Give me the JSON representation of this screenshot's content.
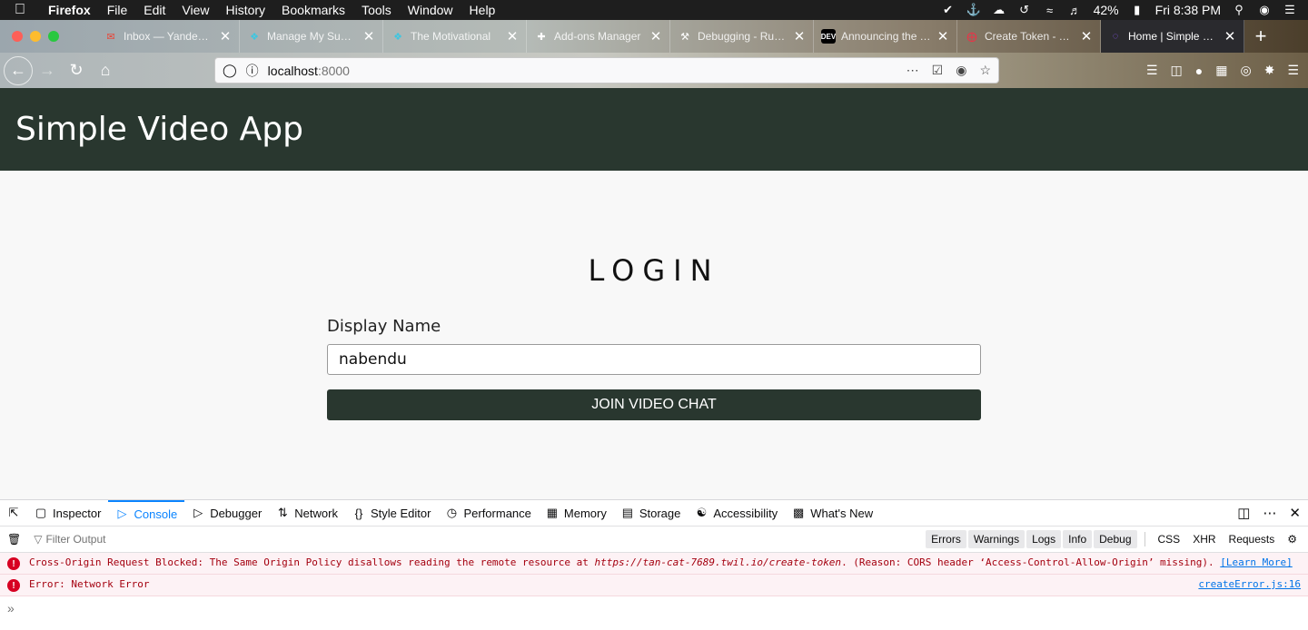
{
  "menubar": {
    "apple": "",
    "items": [
      "Firefox",
      "File",
      "Edit",
      "View",
      "History",
      "Bookmarks",
      "Tools",
      "Window",
      "Help"
    ],
    "battery": "42%",
    "clock": "Fri 8:38 PM"
  },
  "tabs": [
    {
      "label": "Inbox — Yandex.Mail",
      "icon": "mail-icon",
      "color": "#ea4335"
    },
    {
      "label": "Manage My Submissions",
      "icon": "puzzle-icon",
      "color": "#3ec6e0"
    },
    {
      "label": "The Motivational",
      "icon": "puzzle-icon",
      "color": "#3ec6e0"
    },
    {
      "label": "Add-ons Manager",
      "icon": "addon-icon",
      "color": "#ffffff"
    },
    {
      "label": "Debugging - Runtime",
      "icon": "wrench-icon",
      "color": "#ffffff"
    },
    {
      "label": "Announcing the Twilio",
      "icon": "dev-icon",
      "color": "#000000"
    },
    {
      "label": "Create Token - Twilio",
      "icon": "twilio-icon",
      "color": "#f22f46"
    },
    {
      "label": "Home | Simple Video",
      "icon": "app-icon",
      "color": "#9059ff"
    }
  ],
  "urlbar": {
    "host": "localhost",
    "port": ":8000"
  },
  "app": {
    "title": "Simple Video App",
    "login_heading": "LOGIN",
    "display_name_label": "Display Name",
    "display_name_value": "nabendu",
    "join_button": "JOIN VIDEO CHAT"
  },
  "devtools": {
    "tabs": [
      "Inspector",
      "Console",
      "Debugger",
      "Network",
      "Style Editor",
      "Performance",
      "Memory",
      "Storage",
      "Accessibility",
      "What's New"
    ],
    "active_tab": "Console",
    "filter_placeholder": "Filter Output",
    "levels": [
      "Errors",
      "Warnings",
      "Logs",
      "Info",
      "Debug"
    ],
    "requests": [
      "CSS",
      "XHR",
      "Requests"
    ],
    "messages": [
      {
        "text_before": "Cross-Origin Request Blocked: The Same Origin Policy disallows reading the remote resource at ",
        "url": "https://tan-cat-7689.twil.io/create-token",
        "text_after": ". (Reason: CORS header ‘Access-Control-Allow-Origin’ missing). ",
        "link": "[Learn More]"
      },
      {
        "text": "Error: Network Error",
        "source": "createError.js:16"
      }
    ]
  }
}
